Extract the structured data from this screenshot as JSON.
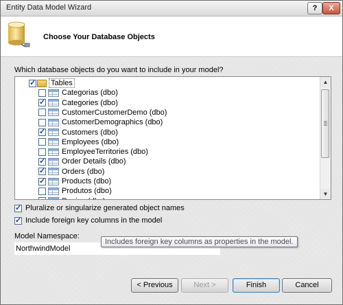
{
  "window": {
    "title": "Entity Data Model Wizard"
  },
  "titlebar": {
    "help_label": "?",
    "close_label": "X"
  },
  "header": {
    "heading": "Choose Your Database Objects"
  },
  "question": "Which database objects do you want to include in your model?",
  "tree": {
    "root": {
      "label": "Tables",
      "checked": true
    },
    "items": [
      {
        "label": "Categorias (dbo)",
        "checked": false
      },
      {
        "label": "Categories (dbo)",
        "checked": true
      },
      {
        "label": "CustomerCustomerDemo (dbo)",
        "checked": false
      },
      {
        "label": "CustomerDemographics (dbo)",
        "checked": false
      },
      {
        "label": "Customers (dbo)",
        "checked": true
      },
      {
        "label": "Employees (dbo)",
        "checked": false
      },
      {
        "label": "EmployeeTerritories (dbo)",
        "checked": false
      },
      {
        "label": "Order Details (dbo)",
        "checked": true
      },
      {
        "label": "Orders (dbo)",
        "checked": true
      },
      {
        "label": "Products (dbo)",
        "checked": true
      },
      {
        "label": "Produtos (dbo)",
        "checked": false
      },
      {
        "label": "Region (dbo)",
        "checked": false
      }
    ]
  },
  "options": {
    "pluralize": {
      "label": "Pluralize or singularize generated object names",
      "checked": true
    },
    "foreign_keys": {
      "label": "Include foreign key columns in the model",
      "checked": true
    }
  },
  "namespace": {
    "label": "Model Namespace:",
    "value": "NorthwindModel"
  },
  "tooltip": "Includes foreign key columns as properties in the model.",
  "buttons": {
    "previous": "< Previous",
    "next": "Next >",
    "finish": "Finish",
    "cancel": "Cancel"
  },
  "scrollbar": {
    "up_icon": "▲",
    "down_icon": "▼"
  }
}
